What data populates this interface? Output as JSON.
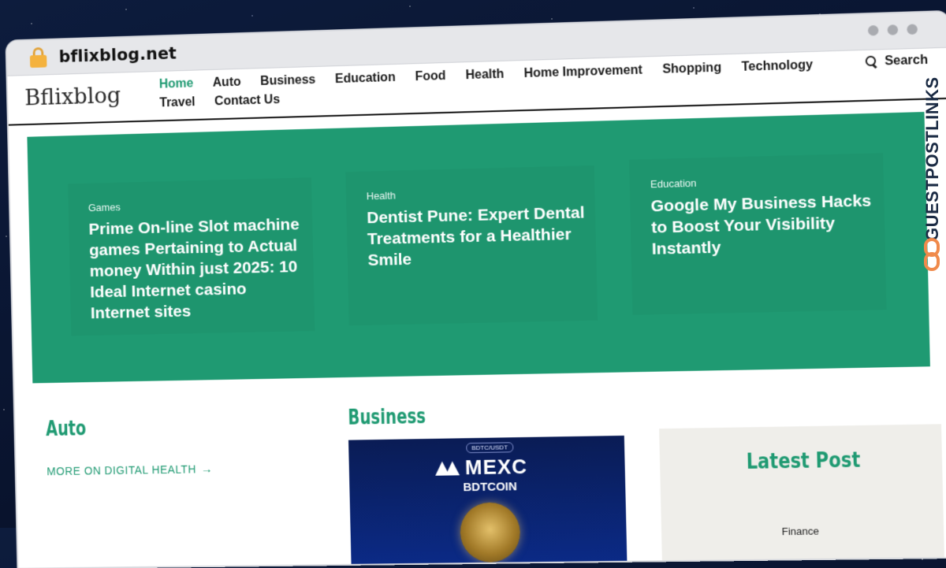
{
  "browser": {
    "url": "bflixblog.net"
  },
  "header": {
    "logo": "Bflixblog",
    "nav": [
      "Home",
      "Auto",
      "Business",
      "Education",
      "Food",
      "Health",
      "Home Improvement",
      "Shopping",
      "Technology",
      "Travel",
      "Contact Us"
    ],
    "active_nav": "Home",
    "search_label": "Search"
  },
  "hero": {
    "cards": [
      {
        "category": "Games",
        "title": "Prime On-line Slot machine games Pertaining to Actual money Within just 2025: 10 Ideal Internet casino Internet sites"
      },
      {
        "category": "Health",
        "title": "Dentist Pune: Expert Dental Treatments for a Healthier Smile"
      },
      {
        "category": "Education",
        "title": "Google My Business Hacks to Boost Your Visibility Instantly"
      }
    ]
  },
  "auto": {
    "title": "Auto",
    "more_link": "MORE ON DIGITAL HEALTH"
  },
  "business": {
    "title": "Business",
    "image": {
      "badge": "BDTC/USDT",
      "brand": "MEXC",
      "coin": "BDTCOIN"
    }
  },
  "sidebar": {
    "title": "Latest Post",
    "category": "Finance"
  },
  "watermark": {
    "text": "GUESTPOSTLINKS"
  },
  "colors": {
    "accent": "#1f9a72",
    "watermark_icon": "#f08a4b"
  },
  "icons": [
    "lock-icon",
    "search-icon",
    "arrow-right-icon",
    "link-icon"
  ]
}
